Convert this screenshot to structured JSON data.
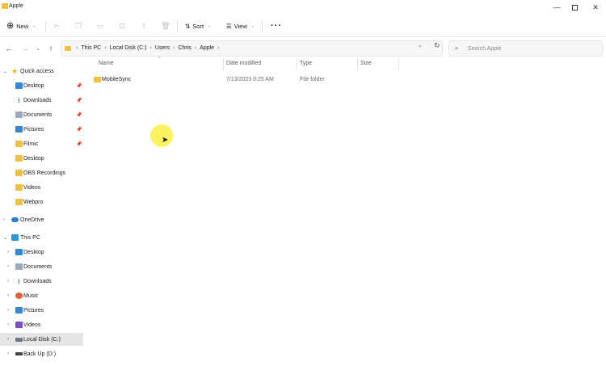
{
  "window": {
    "title": "Apple",
    "minimize": "—",
    "maximize": "",
    "close": "✕"
  },
  "toolbar": {
    "new_label": "New",
    "sort_label": "Sort",
    "view_label": "View",
    "more_label": "···"
  },
  "address": {
    "crumbs": [
      "This PC",
      "Local Disk (C:)",
      "Users",
      "Chris",
      "Apple"
    ],
    "search_placeholder": "Search Apple"
  },
  "sidebar": {
    "items": [
      {
        "label": "Quick access",
        "icon": "star-icon"
      },
      {
        "label": "Desktop",
        "icon": "desktop-icon",
        "pinned": true
      },
      {
        "label": "Downloads",
        "icon": "download-icon",
        "pinned": true
      },
      {
        "label": "Documents",
        "icon": "documents-icon",
        "pinned": true
      },
      {
        "label": "Pictures",
        "icon": "pictures-icon",
        "pinned": true
      },
      {
        "label": "Filmic",
        "icon": "folder-icon",
        "pinned": true
      },
      {
        "label": "Desktop",
        "icon": "folder-icon"
      },
      {
        "label": "OBS Recordings",
        "icon": "folder-icon"
      },
      {
        "label": "Videos",
        "icon": "folder-icon"
      },
      {
        "label": "Webpro",
        "icon": "folder-icon"
      },
      {
        "label": "OneDrive",
        "icon": "cloud-icon"
      },
      {
        "label": "This PC",
        "icon": "pc-icon"
      },
      {
        "label": "Desktop",
        "icon": "desktop-icon"
      },
      {
        "label": "Documents",
        "icon": "documents-icon"
      },
      {
        "label": "Downloads",
        "icon": "download-icon"
      },
      {
        "label": "Music",
        "icon": "music-icon"
      },
      {
        "label": "Pictures",
        "icon": "pictures-icon"
      },
      {
        "label": "Videos",
        "icon": "videos-icon"
      },
      {
        "label": "Local Disk (C:)",
        "icon": "disk-icon",
        "selected": true
      },
      {
        "label": "Back Up (D:)",
        "icon": "drive-icon"
      }
    ]
  },
  "columns": {
    "name": "Name",
    "date": "Date modified",
    "type": "Type",
    "size": "Size"
  },
  "files": [
    {
      "name": "MobileSync",
      "date": "7/13/2023 8:25 AM",
      "type": "File folder",
      "size": ""
    }
  ],
  "colors": {
    "accent": "#0067c0",
    "folder": "#f3c142",
    "selection": "#e5e5e5",
    "cursor_highlight": "#faf046"
  }
}
